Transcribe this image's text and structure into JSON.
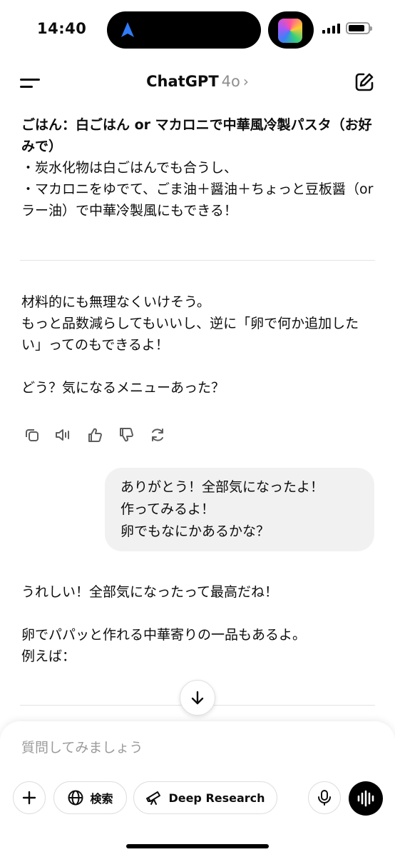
{
  "status_bar": {
    "time": "14:40",
    "battery_level": 0.7,
    "icons": [
      "navigation-arrow-icon",
      "app-activity-icon",
      "cellular-signal-icon",
      "battery-icon"
    ]
  },
  "header": {
    "title": "ChatGPT",
    "model": "4o",
    "chevron": "›",
    "icons": [
      "menu-icon",
      "new-chat-icon"
    ]
  },
  "chat": {
    "assistant_prev": {
      "heading": "ごはん：白ごはん or マカロニで中華風冷製パスタ（お好みで）",
      "line1": "・炭水化物は白ごはんでも合うし、",
      "line2": "・マカロニをゆでて、ごま油＋醤油＋ちょっと豆板醤（orラー油）で中華冷製風にもできる！"
    },
    "assistant_summary": {
      "line1": "材料的にも無理なくいけそう。",
      "line2": "もっと品数減らしてもいいし、逆に「卵で何か追加したい」ってのもできるよ！",
      "line3": "どう？気になるメニューあった？"
    },
    "action_icons": [
      "copy-icon",
      "read-aloud-icon",
      "thumbs-up-icon",
      "thumbs-down-icon",
      "regenerate-icon"
    ],
    "user_message": {
      "line1": "ありがとう！全部気になったよ！",
      "line2": "作ってみるよ！",
      "line3": "卵でもなにかあるかな？"
    },
    "assistant_reply": {
      "line1": "うれしい！全部気になったって最高だね！",
      "line2": "卵でパパッと作れる中華寄りの一品もあるよ。",
      "line3": "例えば："
    }
  },
  "composer": {
    "placeholder": "質問してみましょう",
    "search_label": "検索",
    "deep_research_label": "Deep Research",
    "icons": [
      "plus-icon",
      "globe-icon",
      "telescope-icon",
      "microphone-icon",
      "voice-mode-icon"
    ]
  }
}
